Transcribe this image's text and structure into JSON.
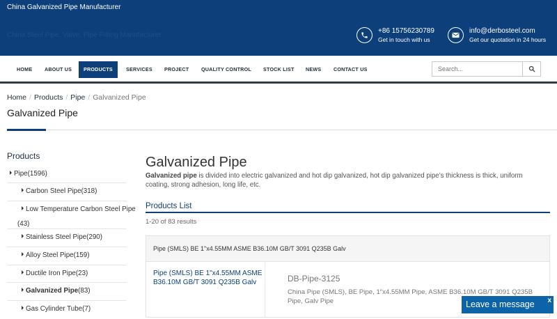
{
  "header": {
    "title": "China Galvanized Pipe Manufacturer",
    "tagline": "China Steel Pipe, Valve, Pipe Fitting Manufacturer",
    "phone": {
      "number": "+86 15756230789",
      "caption": "Get in touch with us",
      "icon": "phone-icon"
    },
    "email": {
      "address": "info@derbosteel.com",
      "caption": "Get our quotation in 24 hours",
      "icon": "envelope-icon"
    }
  },
  "nav": {
    "items": [
      "HOME",
      "ABOUT US",
      "PRODUCTS",
      "SERVICES",
      "PROJECT",
      "QUALITY CONTROL",
      "STOCK LIST",
      "NEWS",
      "CONTACT US"
    ],
    "active": "PRODUCTS",
    "search_placeholder": "Search...",
    "search_icon": "search-icon"
  },
  "breadcrumb": [
    "Home",
    "Products",
    "Pipe",
    "Galvanized Pipe"
  ],
  "page_title": "Galvanized Pipe",
  "sidebar": {
    "heading": "Products",
    "items": [
      {
        "label": "Pipe",
        "count": "(1596)"
      },
      {
        "label": "Carbon Steel Pipe",
        "count": "(318)"
      },
      {
        "label": "Low Temperature Carbon Steel Pipe",
        "count": "(43)"
      },
      {
        "label": "Stainless Steel Pipe",
        "count": "(290)"
      },
      {
        "label": "Alloy Steel Pipe",
        "count": "(159)"
      },
      {
        "label": "Ductile Iron Pipe",
        "count": "(23)"
      },
      {
        "label": "Galvanized Pipe",
        "count": "(83)"
      },
      {
        "label": "Gas Cylinder Tube",
        "count": "(7)"
      }
    ]
  },
  "main": {
    "heading": "Galvanized Pipe",
    "desc_bold": "Galvanized pipe",
    "desc_rest": " is divided into electric galvanized and hot dip galvanized, hot dip galvanized pipe’s thickness is thick, uniform coating, strong adhesion, long life, etc.",
    "products_list": "Products List",
    "results": "1-20 of 83 results",
    "card_header": "Pipe (SMLS) BE 1\"x4.55MM ASME B36.10M GB/T 3091 Q235B Galv",
    "product": {
      "name": "Pipe (SMLS) BE 1\"x4.55MM ASME B36.10M GB/T 3091 Q235B Galv",
      "code": "DB-Pipe-3125",
      "keywords": "China Pipe (SMLS), BE Pipe, 1\"x4.55MM Pipe, ASME B36.10M GB/T 3091 Q235B Pipe, Galv Pipe"
    }
  },
  "chat": {
    "label": "Leave a message",
    "close": "x"
  }
}
